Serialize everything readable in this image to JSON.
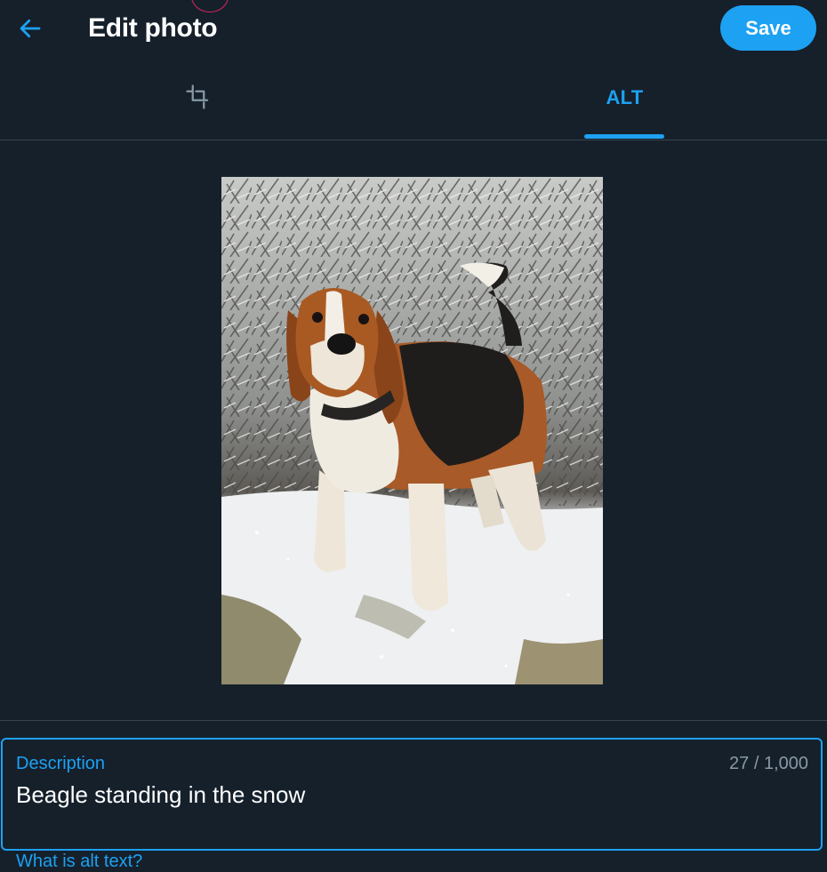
{
  "header": {
    "title": "Edit photo",
    "save_label": "Save",
    "back_icon": "arrow-left-icon"
  },
  "tabs": [
    {
      "icon": "crop-icon",
      "label": "",
      "active": false
    },
    {
      "icon": "",
      "label": "ALT",
      "active": true
    }
  ],
  "photo": {
    "subject": "beagle-in-snow-photo"
  },
  "description": {
    "label": "Description",
    "counter": "27 / 1,000",
    "value": "Beagle standing in the snow"
  },
  "help_link": "What is alt text?",
  "colors": {
    "background": "#15202b",
    "accent": "#1da1f2",
    "muted": "#8899a6",
    "border": "#38444d"
  }
}
